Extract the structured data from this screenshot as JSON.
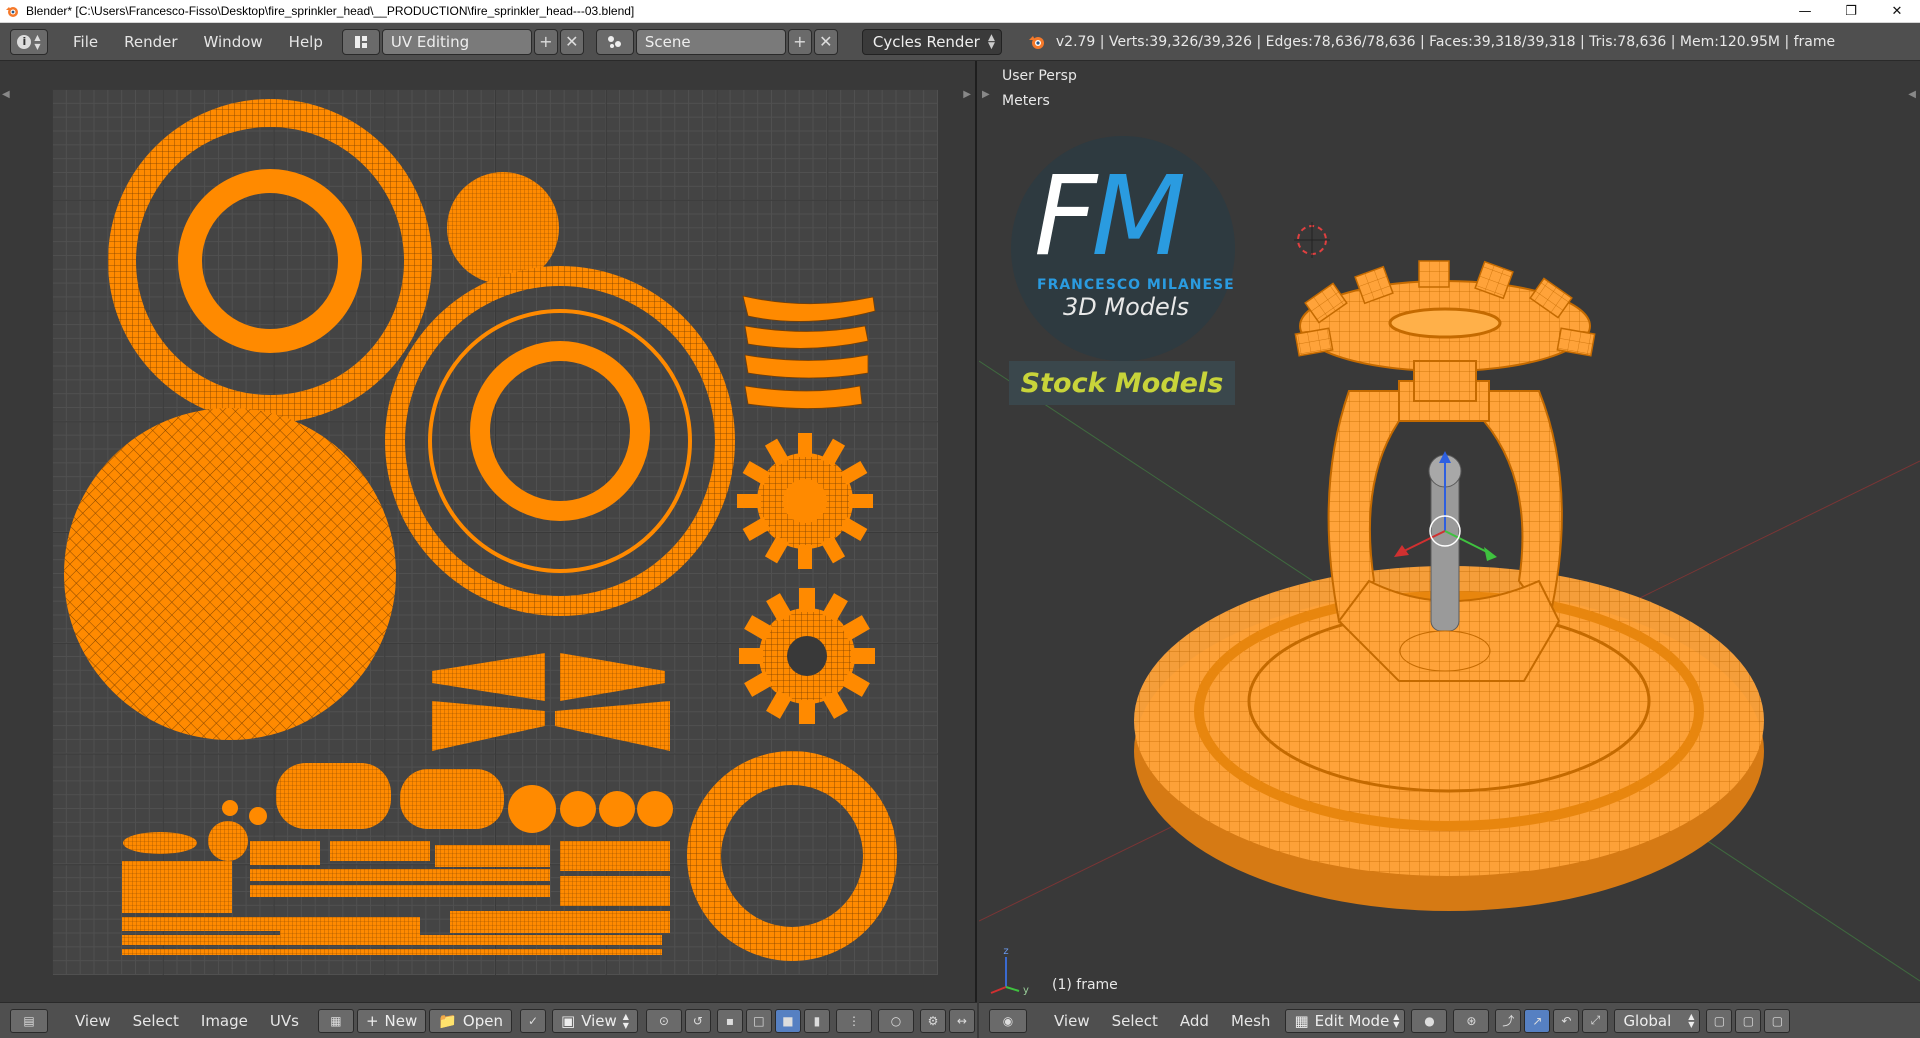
{
  "titlebar": {
    "title": "Blender* [C:\\Users\\Francesco-Fisso\\Desktop\\fire_sprinkler_head\\__PRODUCTION\\fire_sprinkler_head---03.blend]"
  },
  "topbar": {
    "menus": [
      "File",
      "Render",
      "Window",
      "Help"
    ],
    "screen_layout": "UV Editing",
    "scene": "Scene",
    "render_engine": "Cycles Render",
    "stats": "v2.79 | Verts:39,326/39,326 | Edges:78,636/78,636 | Faces:39,318/39,318 | Tris:78,636 | Mem:120.95M | frame"
  },
  "viewport": {
    "view_name": "User Persp",
    "units": "Meters",
    "frame_label": "(1) frame",
    "logo": {
      "initials": "FM",
      "name": "FRANCESCO MILANESE",
      "sub": "3D Models",
      "banner": "Stock Models"
    }
  },
  "uv_bottombar": {
    "menus": [
      "View",
      "Select",
      "Image",
      "UVs"
    ],
    "new_label": "New",
    "open_label": "Open",
    "view_label": "View"
  },
  "vp_bottombar": {
    "menus": [
      "View",
      "Select",
      "Add",
      "Mesh"
    ],
    "mode": "Edit Mode",
    "orientation": "Global"
  },
  "colors": {
    "uv_orange": "#ff8a00",
    "header_bg": "#4f4f4f",
    "editor_bg": "#393939",
    "active_blue": "#5680c2"
  }
}
